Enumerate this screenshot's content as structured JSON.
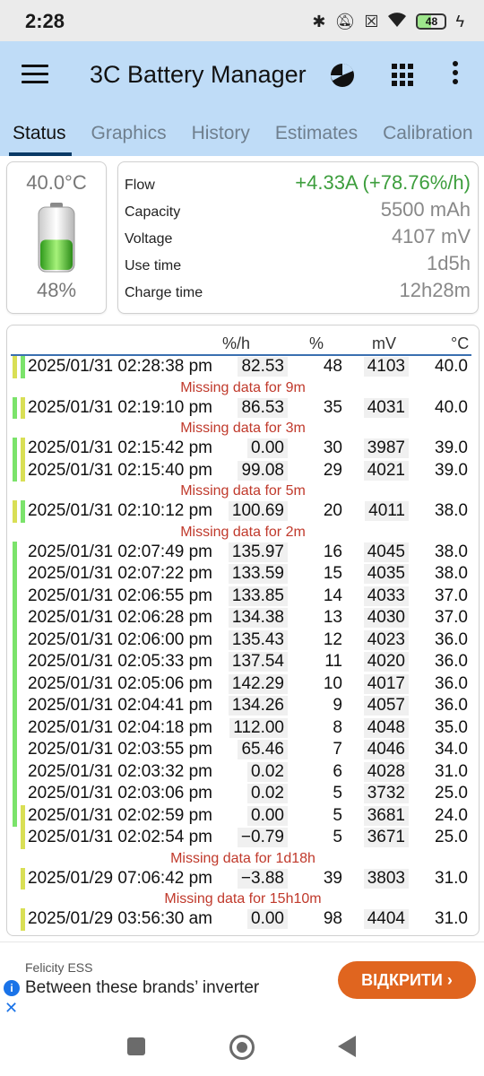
{
  "status_bar": {
    "time": "2:28",
    "battery": "48",
    "battery_level_pct": 48
  },
  "app": {
    "title": "3C Battery Manager"
  },
  "tabs": [
    {
      "label": "Status",
      "active": true
    },
    {
      "label": "Graphics"
    },
    {
      "label": "History"
    },
    {
      "label": "Estimates"
    },
    {
      "label": "Calibration"
    }
  ],
  "status": {
    "temperature": "40.0°C",
    "level": "48%",
    "level_value": 48,
    "info": [
      {
        "label": "Flow",
        "value": "+4.33A (+78.76%/h)"
      },
      {
        "label": "Capacity",
        "value": "5500 mAh"
      },
      {
        "label": "Voltage",
        "value": "4107 mV"
      },
      {
        "label": "Use time",
        "value": "1d5h"
      },
      {
        "label": "Charge time",
        "value": "12h28m"
      }
    ]
  },
  "history": {
    "headers": {
      "rate": "%/h",
      "pct": "%",
      "mv": "mV",
      "temp": "°C"
    },
    "colors": {
      "charging": "#7be36b",
      "discharging": "#d9df55"
    },
    "rows": [
      {
        "type": "data",
        "date": "2025/01/31  02:28:38 pm",
        "rate": "82.53",
        "pct": "48",
        "mv": "4103",
        "temp": "40.0",
        "bars": [
          "discharging",
          "charging"
        ]
      },
      {
        "type": "missing",
        "text": "Missing data for 9m"
      },
      {
        "type": "data",
        "date": "2025/01/31  02:19:10 pm",
        "rate": "86.53",
        "pct": "35",
        "mv": "4031",
        "temp": "40.0",
        "bars": [
          "charging",
          "discharging"
        ]
      },
      {
        "type": "missing",
        "text": "Missing data for 3m"
      },
      {
        "type": "data",
        "date": "2025/01/31  02:15:42 pm",
        "rate": "0.00",
        "pct": "30",
        "mv": "3987",
        "temp": "39.0",
        "bars": [
          "charging",
          "discharging"
        ]
      },
      {
        "type": "data",
        "date": "2025/01/31  02:15:40 pm",
        "rate": "99.08",
        "pct": "29",
        "mv": "4021",
        "temp": "39.0",
        "bars": [
          "charging",
          "discharging"
        ]
      },
      {
        "type": "missing",
        "text": "Missing data for 5m"
      },
      {
        "type": "data",
        "date": "2025/01/31  02:10:12 pm",
        "rate": "100.69",
        "pct": "20",
        "mv": "4011",
        "temp": "38.0",
        "bars": [
          "discharging",
          "charging"
        ]
      },
      {
        "type": "missing",
        "text": "Missing data for 2m"
      },
      {
        "type": "data",
        "date": "2025/01/31  02:07:49 pm",
        "rate": "135.97",
        "pct": "16",
        "mv": "4045",
        "temp": "38.0",
        "bars": [
          "charging"
        ]
      },
      {
        "type": "data",
        "date": "2025/01/31  02:07:22 pm",
        "rate": "133.59",
        "pct": "15",
        "mv": "4035",
        "temp": "38.0",
        "bars": [
          "charging"
        ]
      },
      {
        "type": "data",
        "date": "2025/01/31  02:06:55 pm",
        "rate": "133.85",
        "pct": "14",
        "mv": "4033",
        "temp": "37.0",
        "bars": [
          "charging"
        ]
      },
      {
        "type": "data",
        "date": "2025/01/31  02:06:28 pm",
        "rate": "134.38",
        "pct": "13",
        "mv": "4030",
        "temp": "37.0",
        "bars": [
          "charging"
        ]
      },
      {
        "type": "data",
        "date": "2025/01/31  02:06:00 pm",
        "rate": "135.43",
        "pct": "12",
        "mv": "4023",
        "temp": "36.0",
        "bars": [
          "charging"
        ]
      },
      {
        "type": "data",
        "date": "2025/01/31  02:05:33 pm",
        "rate": "137.54",
        "pct": "11",
        "mv": "4020",
        "temp": "36.0",
        "bars": [
          "charging"
        ]
      },
      {
        "type": "data",
        "date": "2025/01/31  02:05:06 pm",
        "rate": "142.29",
        "pct": "10",
        "mv": "4017",
        "temp": "36.0",
        "bars": [
          "charging"
        ]
      },
      {
        "type": "data",
        "date": "2025/01/31  02:04:41 pm",
        "rate": "134.26",
        "pct": "9",
        "mv": "4057",
        "temp": "36.0",
        "bars": [
          "charging"
        ]
      },
      {
        "type": "data",
        "date": "2025/01/31  02:04:18 pm",
        "rate": "112.00",
        "pct": "8",
        "mv": "4048",
        "temp": "35.0",
        "bars": [
          "charging"
        ]
      },
      {
        "type": "data",
        "date": "2025/01/31  02:03:55 pm",
        "rate": "65.46",
        "pct": "7",
        "mv": "4046",
        "temp": "34.0",
        "bars": [
          "charging"
        ]
      },
      {
        "type": "data",
        "date": "2025/01/31  02:03:32 pm",
        "rate": "0.02",
        "pct": "6",
        "mv": "4028",
        "temp": "31.0",
        "bars": [
          "charging"
        ]
      },
      {
        "type": "data",
        "date": "2025/01/31  02:03:06 pm",
        "rate": "0.02",
        "pct": "5",
        "mv": "3732",
        "temp": "25.0",
        "bars": [
          "charging"
        ]
      },
      {
        "type": "data",
        "date": "2025/01/31  02:02:59 pm",
        "rate": "0.00",
        "pct": "5",
        "mv": "3681",
        "temp": "24.0",
        "bars": [
          "charging",
          "discharging"
        ]
      },
      {
        "type": "data",
        "date": "2025/01/31  02:02:54 pm",
        "rate": "−0.79",
        "pct": "5",
        "mv": "3671",
        "temp": "25.0",
        "bars": [
          "none",
          "discharging"
        ]
      },
      {
        "type": "missing",
        "text": "Missing data for 1d18h"
      },
      {
        "type": "data",
        "date": "2025/01/29  07:06:42 pm",
        "rate": "−3.88",
        "pct": "39",
        "mv": "3803",
        "temp": "31.0",
        "bars": [
          "none",
          "discharging"
        ]
      },
      {
        "type": "missing",
        "text": "Missing data for 15h10m"
      },
      {
        "type": "data",
        "date": "2025/01/29  03:56:30 am",
        "rate": "0.00",
        "pct": "98",
        "mv": "4404",
        "temp": "31.0",
        "bars": [
          "none",
          "discharging"
        ]
      }
    ]
  },
  "ad": {
    "advertiser": "Felicity ESS",
    "headline": "Between these brands’ inverter",
    "button": "ВІДКРИТИ"
  }
}
